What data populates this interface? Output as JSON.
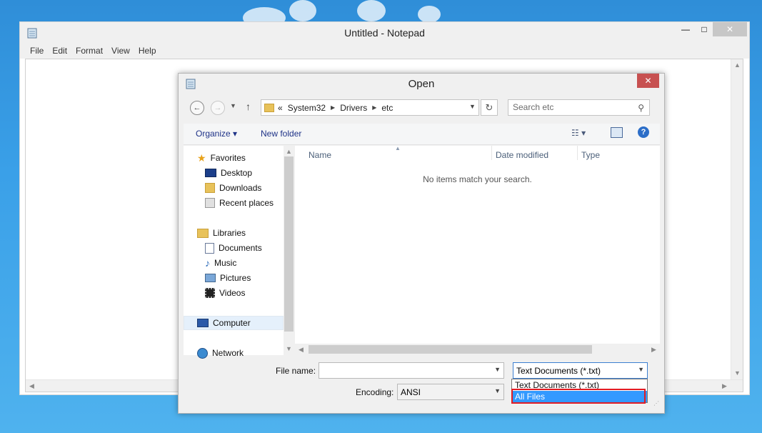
{
  "notepad": {
    "title": "Untitled - Notepad",
    "window_controls": {
      "minimize": "—",
      "maximize": "□",
      "close": "✕"
    },
    "menu": [
      "File",
      "Edit",
      "Format",
      "View",
      "Help"
    ]
  },
  "dialog": {
    "title": "Open",
    "close_label": "✕",
    "address": {
      "prefix": "«",
      "segments": [
        "System32",
        "Drivers",
        "etc"
      ]
    },
    "search": {
      "placeholder": "Search etc"
    },
    "toolbar": {
      "organize": "Organize ▾",
      "new_folder": "New folder",
      "views": "☷ ▾",
      "help": "?"
    },
    "nav_tree": [
      {
        "label": "Favorites",
        "icon": "star-icon"
      },
      {
        "label": "Desktop",
        "icon": "desktop-icon"
      },
      {
        "label": "Downloads",
        "icon": "downloads-icon"
      },
      {
        "label": "Recent places",
        "icon": "recent-places-icon"
      },
      {
        "label": "Libraries",
        "icon": "libraries-icon"
      },
      {
        "label": "Documents",
        "icon": "documents-icon"
      },
      {
        "label": "Music",
        "icon": "music-icon"
      },
      {
        "label": "Pictures",
        "icon": "pictures-icon"
      },
      {
        "label": "Videos",
        "icon": "videos-icon"
      },
      {
        "label": "Computer",
        "icon": "computer-icon"
      },
      {
        "label": "Network",
        "icon": "network-icon"
      }
    ],
    "columns": [
      "Name",
      "Date modified",
      "Type"
    ],
    "empty_message": "No items match your search.",
    "file_name": {
      "label": "File name:",
      "value": ""
    },
    "encoding": {
      "label": "Encoding:",
      "value": "ANSI"
    },
    "file_type": {
      "selected": "Text Documents (*.txt)",
      "options": [
        "Text Documents (*.txt)",
        "All Files"
      ],
      "highlighted": "All Files"
    },
    "colors": {
      "accent": "#3399ff",
      "highlight_box": "#e11b24",
      "close_button": "#c75050"
    }
  }
}
